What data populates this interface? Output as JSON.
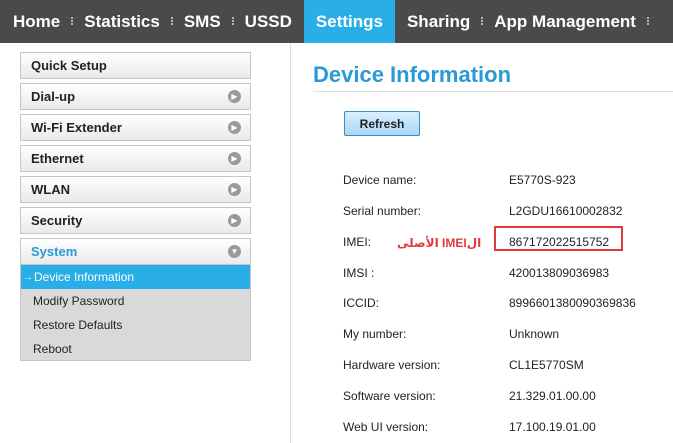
{
  "nav": {
    "items": [
      {
        "label": "Home"
      },
      {
        "label": "Statistics"
      },
      {
        "label": "SMS"
      },
      {
        "label": "USSD"
      },
      {
        "label": "Settings"
      },
      {
        "label": "Sharing"
      },
      {
        "label": "App Management"
      }
    ],
    "active": "Settings"
  },
  "sidebar": {
    "items": [
      {
        "label": "Quick Setup"
      },
      {
        "label": "Dial-up"
      },
      {
        "label": "Wi-Fi Extender"
      },
      {
        "label": "Ethernet"
      },
      {
        "label": "WLAN"
      },
      {
        "label": "Security"
      },
      {
        "label": "System"
      }
    ],
    "submenu": [
      {
        "label": "Device Information"
      },
      {
        "label": "Modify Password"
      },
      {
        "label": "Restore Defaults"
      },
      {
        "label": "Reboot"
      }
    ]
  },
  "main": {
    "title": "Device Information",
    "refresh_label": "Refresh",
    "annotation": "الIMEI الأصلى",
    "rows": [
      {
        "label": "Device name:",
        "value": "E5770S-923"
      },
      {
        "label": "Serial number:",
        "value": "L2GDU16610002832"
      },
      {
        "label": "IMEI:",
        "value": "867172022515752"
      },
      {
        "label": "IMSI :",
        "value": "420013809036983"
      },
      {
        "label": "ICCID:",
        "value": "8996601380090369836"
      },
      {
        "label": "My number:",
        "value": "Unknown"
      },
      {
        "label": "Hardware version:",
        "value": "CL1E5770SM"
      },
      {
        "label": "Software version:",
        "value": "21.329.01.00.00"
      },
      {
        "label": "Web UI version:",
        "value": "17.100.19.01.00"
      }
    ]
  },
  "colors": {
    "nav_bg": "#4a4a4a",
    "accent": "#2aaee8",
    "title_blue": "#2a9ad6",
    "highlight_red": "#e03a3a"
  }
}
